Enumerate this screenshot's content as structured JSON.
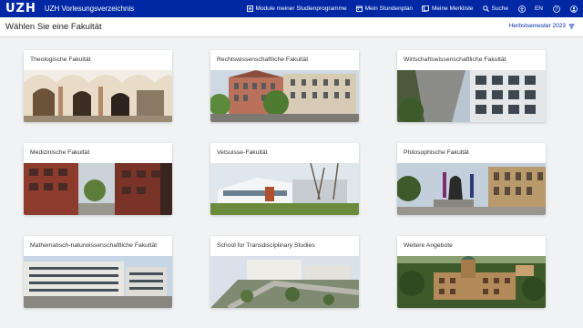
{
  "header": {
    "logo": "UZH",
    "app_title": "UZH Vorlesungsverzeichnis",
    "nav": {
      "modules": "Module meiner Studienprogramme",
      "schedule": "Mein Stundenplan",
      "watchlist": "Meine Merkliste",
      "search": "Suche",
      "language": "EN"
    }
  },
  "subheader": {
    "title": "Wählen Sie eine Fakultät",
    "semester": "Herbstsemester 2023"
  },
  "faculties": [
    {
      "title": "Theologische Fakultät"
    },
    {
      "title": "Rechtswissenschaftliche Fakultät"
    },
    {
      "title": "Wirtschaftswissenschaftliche Fakultät"
    },
    {
      "title": "Medizinische Fakultät"
    },
    {
      "title": "Vetsuisse-Fakultät"
    },
    {
      "title": "Philosophische Fakultät"
    },
    {
      "title": "Mathematisch-naturwissenschaftliche Fakultät"
    },
    {
      "title": "School for Transdisciplinary Studies"
    },
    {
      "title": "Weitere Angebote"
    }
  ],
  "colors": {
    "brand": "#0028a5",
    "background": "#f1f2f4"
  }
}
